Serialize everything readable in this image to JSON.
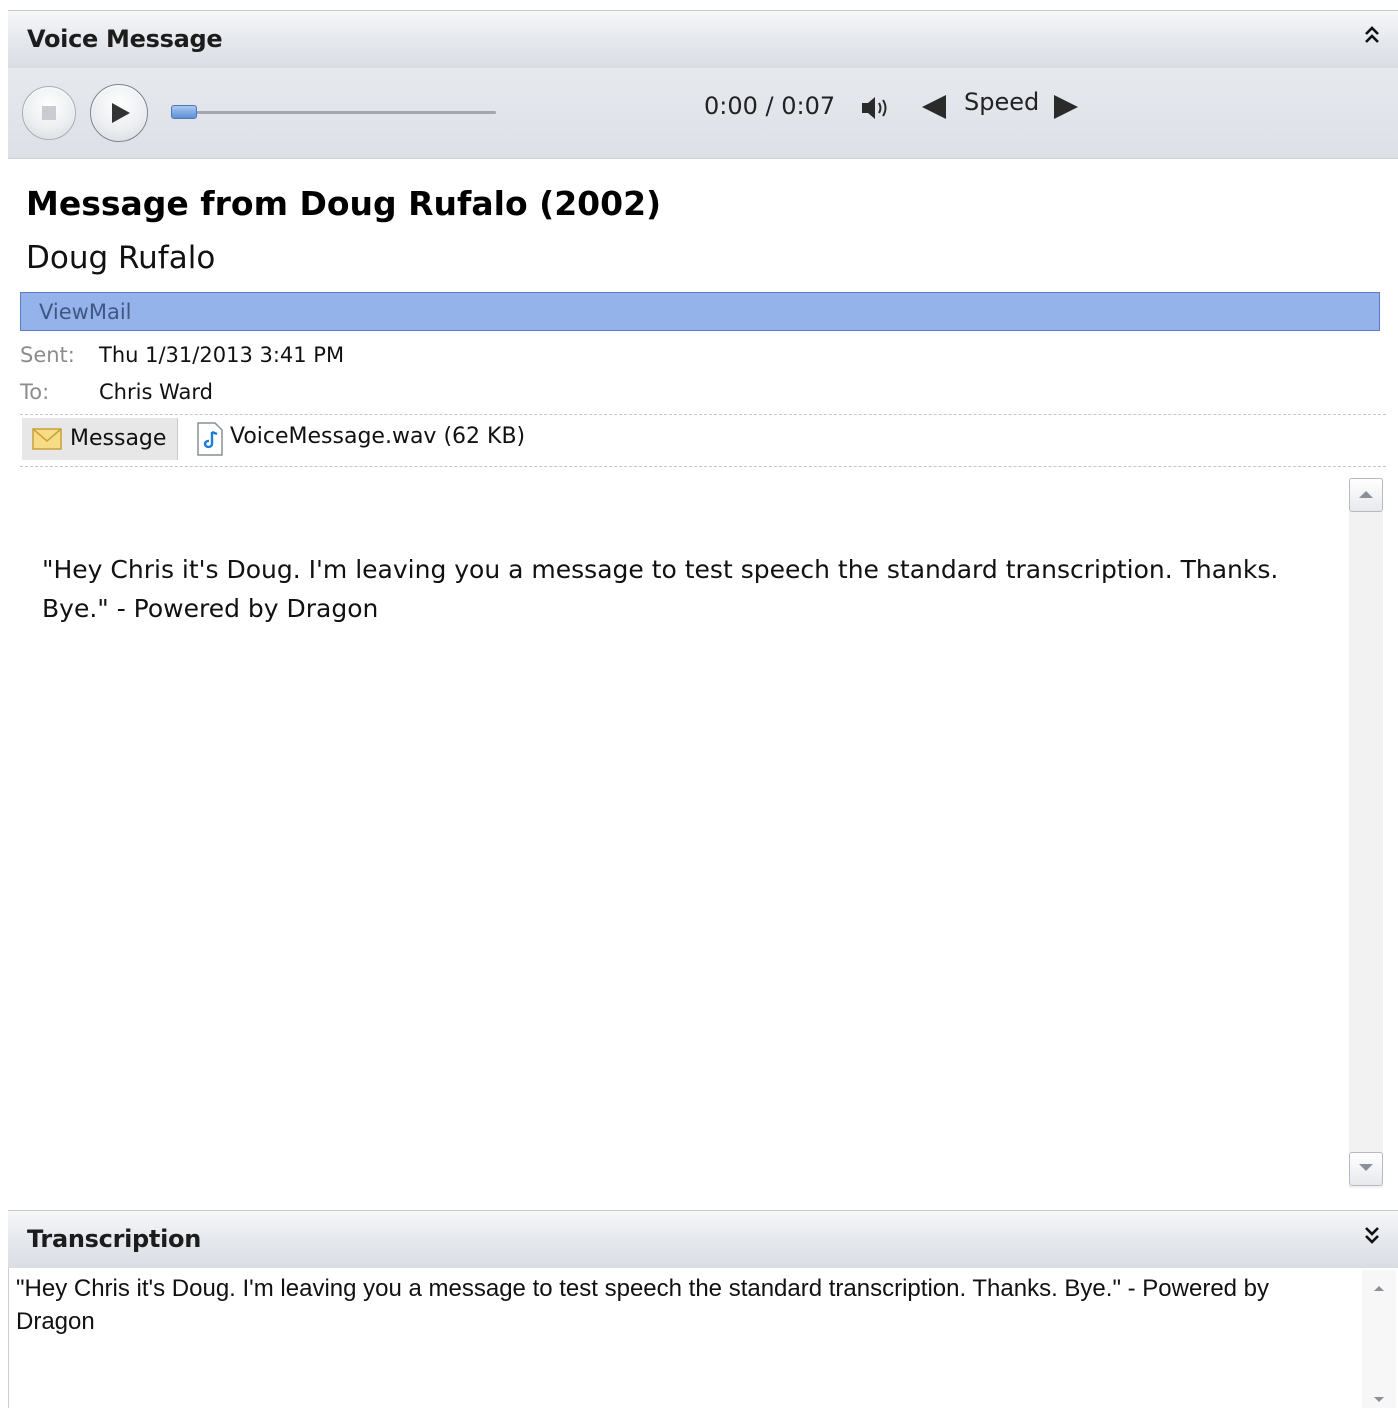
{
  "voice_panel": {
    "title": "Voice Message",
    "collapse_glyph": "⌃",
    "player": {
      "time": "0:00 / 0:07",
      "speed_label": "Speed",
      "progress_fraction": 0.0,
      "icons": [
        "stop-icon",
        "play-icon",
        "volume-icon",
        "speed-decrease-icon",
        "speed-increase-icon"
      ]
    }
  },
  "message": {
    "subject": "Message from Doug Rufalo (2002)",
    "sender": "Doug Rufalo",
    "category": "ViewMail",
    "category_color": "#94b3ea",
    "sent_label": "Sent:",
    "sent_value": "Thu 1/31/2013 3:41 PM",
    "to_label": "To:",
    "to_value": "Chris Ward",
    "attachments": {
      "message_tab": "Message",
      "file": "VoiceMessage.wav (62 KB)"
    },
    "body": "\"Hey Chris it's Doug. I'm leaving you a message to test speech the standard transcription. Thanks. Bye.\" - Powered by Dragon"
  },
  "transcription_panel": {
    "title": "Transcription",
    "expand_glyph": "⌄",
    "text": "\"Hey Chris it's Doug. I'm leaving you a message to test speech the standard transcription. Thanks. Bye.\" - Powered by Dragon"
  }
}
